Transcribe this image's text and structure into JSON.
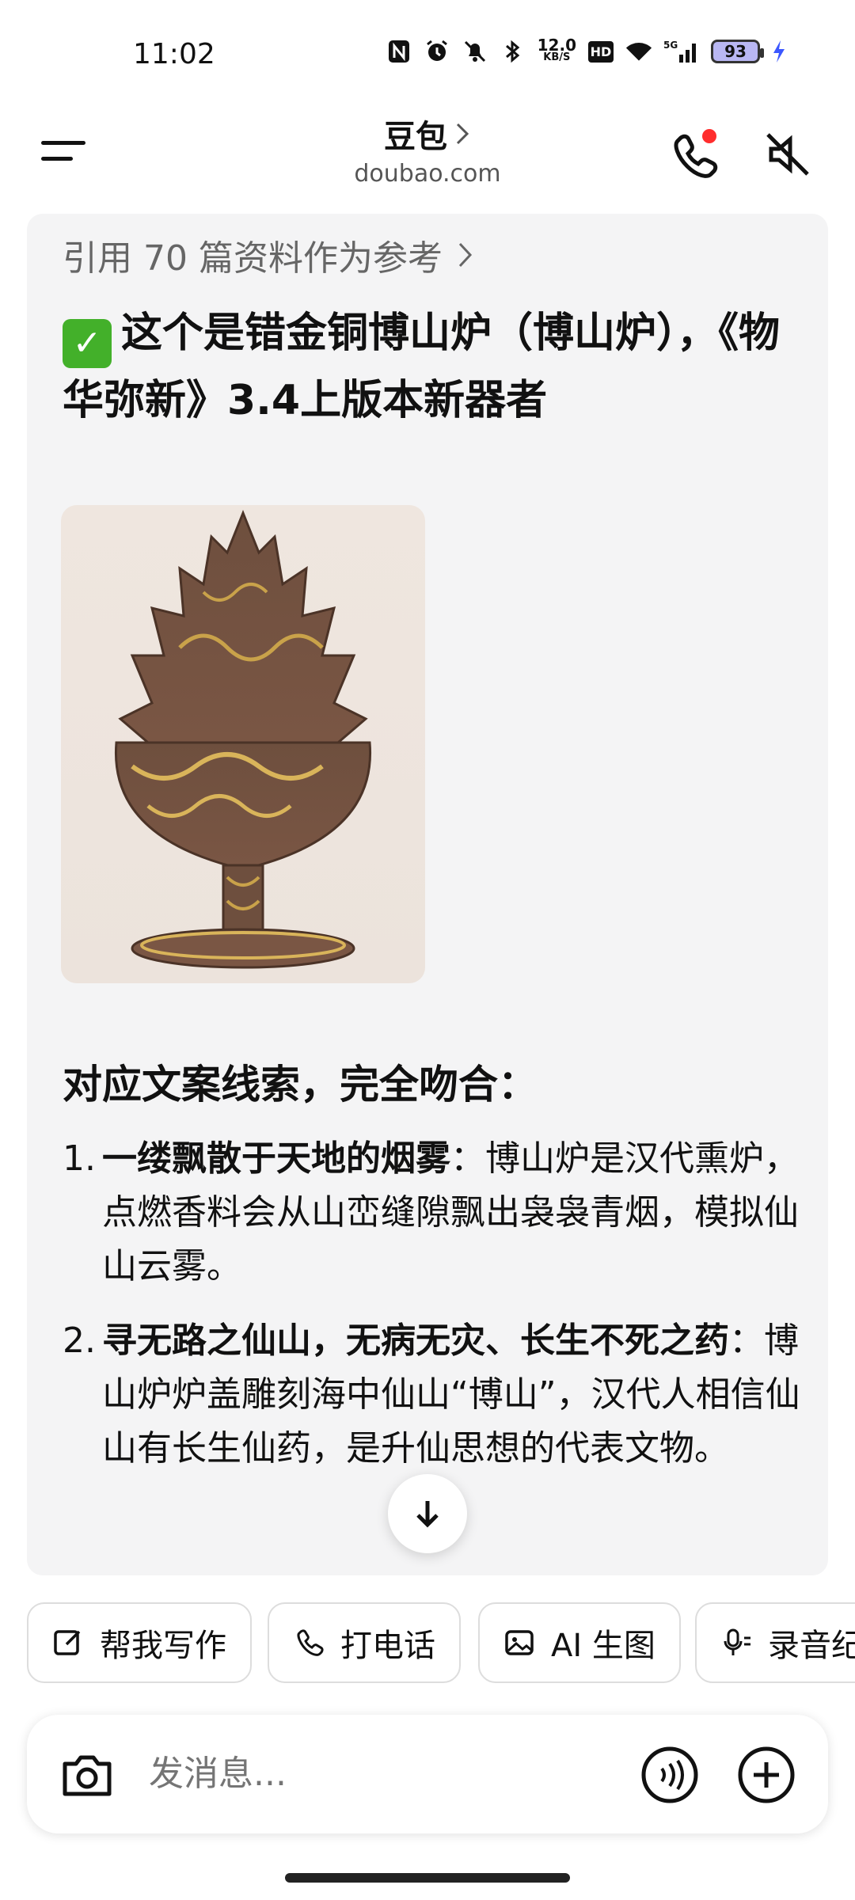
{
  "status": {
    "time": "11:02",
    "net_speed_value": "12.0",
    "net_speed_unit": "KB/S",
    "hd": "HD",
    "signal": "5G",
    "battery": "93",
    "icons": [
      "nfc-icon",
      "alarm-icon",
      "bell-off-icon",
      "bluetooth-icon",
      "wifi-icon",
      "cell-signal-icon",
      "charging-icon"
    ]
  },
  "header": {
    "title": "豆包",
    "subtitle": "doubao.com",
    "has_call_notification": true
  },
  "message": {
    "refs": "引用 70 篇资料作为参考",
    "headline": "这个是错金铜博山炉（博山炉），《物华弥新》3.4上版本新器者",
    "section_title": "对应文案线索，完全吻合：",
    "items": [
      {
        "num": "1.",
        "bold": "一缕飘散于天地的烟雾",
        "text": "：博山炉是汉代熏炉，点燃香料会从山峦缝隙飘出袅袅青烟，模拟仙山云雾。"
      },
      {
        "num": "2.",
        "bold": "寻无路之仙山，无病无灾、长生不死之药",
        "text": "：博山炉炉盖雕刻海中仙山“博山”，汉代人相信仙山有长生仙药，是升仙思想的代表文物。"
      }
    ]
  },
  "chips": [
    {
      "label": "帮我写作",
      "icon": "edit-icon"
    },
    {
      "label": "打电话",
      "icon": "phone-icon"
    },
    {
      "label": "AI 生图",
      "icon": "image-icon"
    },
    {
      "label": "录音纪",
      "icon": "mic-icon"
    }
  ],
  "composer": {
    "placeholder": "发消息..."
  },
  "colors": {
    "accent_red": "#ff2d2d",
    "check_green": "#43b02a",
    "card_bg": "#f4f4f5"
  }
}
